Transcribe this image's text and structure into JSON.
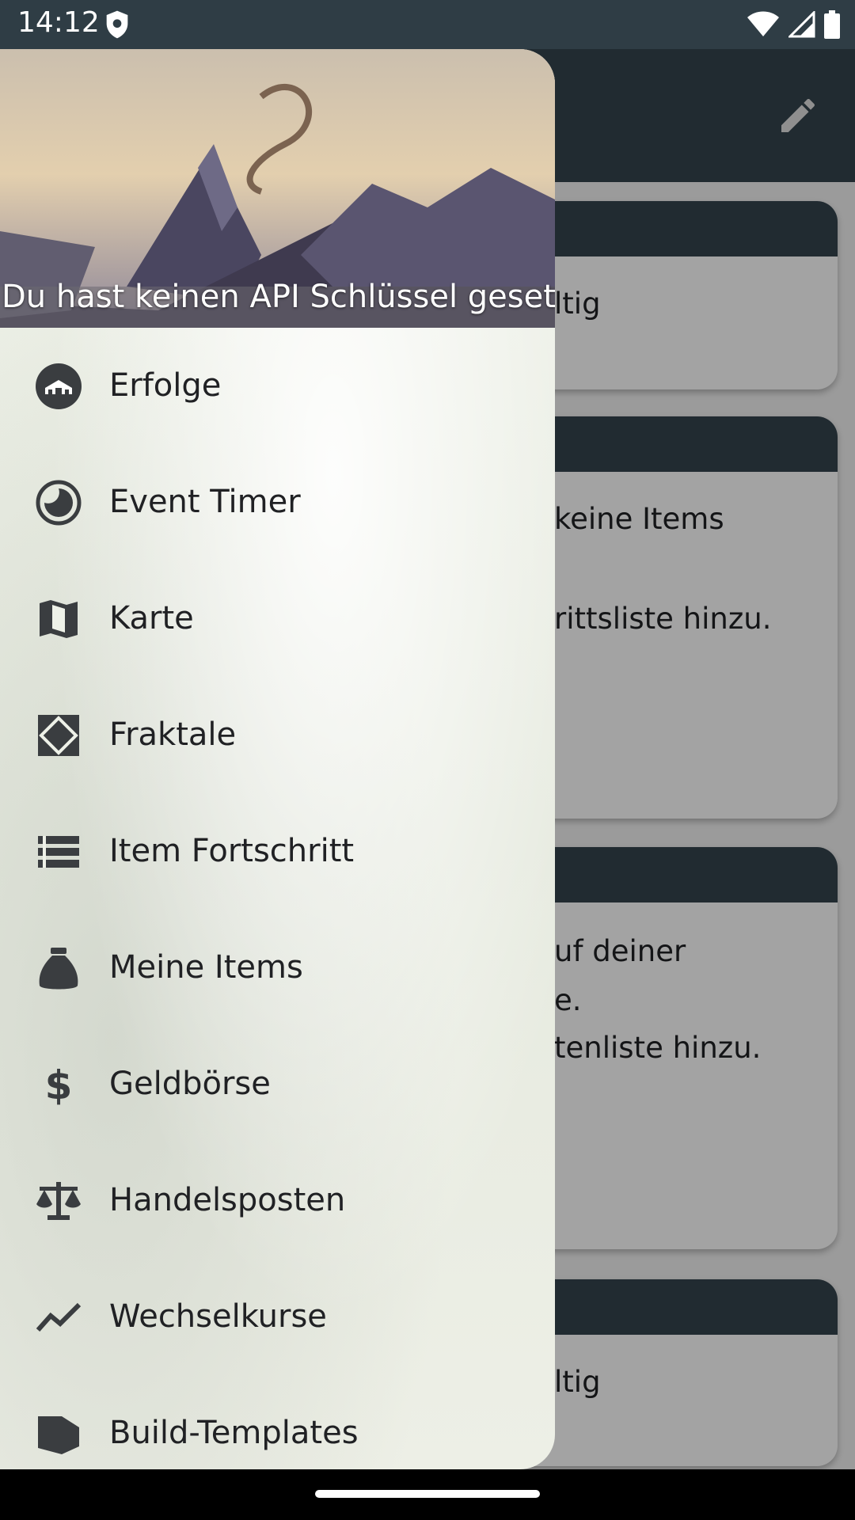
{
  "status_bar": {
    "time": "14:12",
    "icons": [
      "shield-icon",
      "wifi-icon",
      "signal-icon",
      "battery-icon"
    ]
  },
  "app_bar": {
    "action_icon": "edit-icon"
  },
  "background_cards": [
    {
      "lines": [
        "ltig"
      ]
    },
    {
      "lines": [
        "keine Items",
        "rittsliste hinzu."
      ]
    },
    {
      "lines": [
        "uf deiner",
        "e.",
        "tenliste hinzu."
      ]
    },
    {
      "lines": [
        "ltig"
      ]
    }
  ],
  "drawer": {
    "header_text": "Du hast keinen API Schlüssel gesetzt.",
    "items": [
      {
        "label": "Erfolge",
        "icon": "achievement-icon"
      },
      {
        "label": "Event Timer",
        "icon": "timer-icon"
      },
      {
        "label": "Karte",
        "icon": "map-icon"
      },
      {
        "label": "Fraktale",
        "icon": "fractal-icon"
      },
      {
        "label": "Item Fortschritt",
        "icon": "list-icon"
      },
      {
        "label": "Meine Items",
        "icon": "bag-icon"
      },
      {
        "label": "Geldbörse",
        "icon": "dollar-icon"
      },
      {
        "label": "Handelsposten",
        "icon": "scale-icon"
      },
      {
        "label": "Wechselkurse",
        "icon": "trend-icon"
      },
      {
        "label": "Build-Templates",
        "icon": "template-icon"
      }
    ]
  },
  "colors": {
    "app_bar": "#34444d",
    "status_bar": "#2f3d45",
    "drawer_background": "#eef1e8"
  }
}
